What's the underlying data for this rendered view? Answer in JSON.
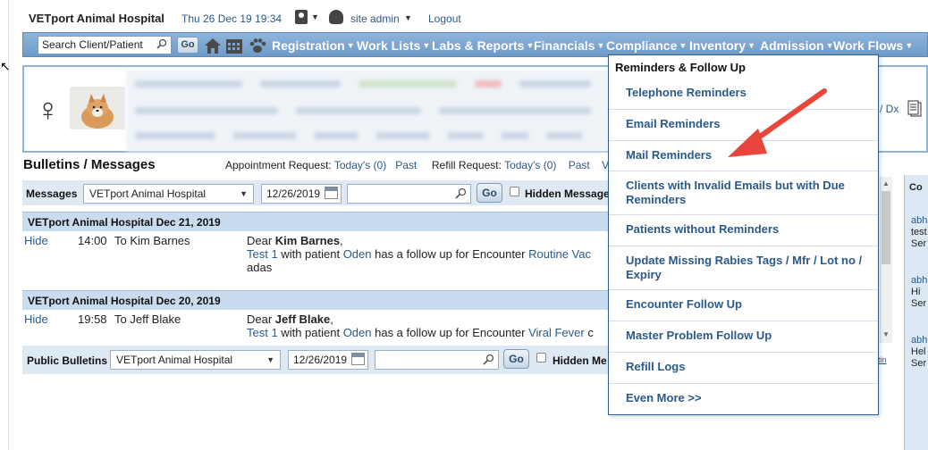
{
  "header": {
    "hospital_name": "VETport Animal Hospital",
    "datetime": "Thu 26 Dec 19 19:34",
    "user_label": "site admin",
    "logout_label": "Logout"
  },
  "nav": {
    "search_placeholder": "Search Client/Patient",
    "go_label": "Go",
    "items": [
      {
        "label": "Registration"
      },
      {
        "label": "Work Lists"
      },
      {
        "label": "Labs & Reports"
      },
      {
        "label": "Financials"
      },
      {
        "label": "Compliance"
      },
      {
        "label": "Inventory"
      },
      {
        "label": "Admission"
      },
      {
        "label": "Work Flows"
      }
    ]
  },
  "patient_card": {
    "dx_link": "/ Dx"
  },
  "bulletins": {
    "title": "Bulletins / Messages",
    "appointment_request_label": "Appointment Request:",
    "appointment_today": "Today's (0)",
    "appointment_past": "Past",
    "refill_request_label": "Refill Request:",
    "refill_today": "Today's (0)",
    "refill_past": "Past",
    "trailing": "V"
  },
  "messages_toolbar": {
    "label": "Messages",
    "hospital_select": "VETport Animal Hospital",
    "date": "12/26/2019",
    "go_label": "Go",
    "hidden_label": "Hidden Messages"
  },
  "messages": [
    {
      "header": "VETport Animal Hospital  Dec 21, 2019",
      "hide": "Hide",
      "time": "14:00",
      "to": "To Kim Barnes",
      "greeting": "Dear ",
      "name": "Kim Barnes",
      "comma": ",",
      "test_link": "Test 1",
      "with_patient": " with patient ",
      "patient_link": "Oden",
      "has_follow": " has a follow up for Encounter ",
      "encounter_link": "Routine Vac",
      "extra_line": "adas"
    },
    {
      "header": "VETport Animal Hospital  Dec 20, 2019",
      "hide": "Hide",
      "time": "19:58",
      "to": "To Jeff Blake",
      "greeting": "Dear ",
      "name": "Jeff Blake",
      "comma": ",",
      "test_link": "Test 1",
      "with_patient": " with patient ",
      "patient_link": "Oden",
      "has_follow": " has a follow up for Encounter ",
      "encounter_link": "Viral Fever",
      "trailing": " c"
    }
  ],
  "public_toolbar": {
    "label": "Public Bulletins",
    "hospital_select": "VETport Animal Hospital",
    "date": "12/26/2019",
    "go_label": "Go",
    "hidden_label": "Hidden Me",
    "right_link": "tin"
  },
  "right_panel": {
    "header": "Co",
    "entries": [
      {
        "line1": "abh",
        "line2": "test",
        "line3": "Ser"
      },
      {
        "line1": "abh",
        "line2": "Hi",
        "line3": "Ser"
      },
      {
        "line1": "abh",
        "line2": "Hel",
        "line3": "Ser"
      }
    ]
  },
  "dropdown": {
    "title": "Reminders & Follow Up",
    "items": [
      {
        "line1": "Telephone Reminders"
      },
      {
        "line1": "Email Reminders"
      },
      {
        "line1": "Mail Reminders"
      },
      {
        "line1": "Clients with Invalid Emails but with Due",
        "line2": "Reminders"
      },
      {
        "line1": "Patients without Reminders"
      },
      {
        "line1": "Update Missing Rabies Tags / Mfr / Lot no /",
        "line2": "Expiry"
      },
      {
        "line1": "Encounter Follow Up"
      },
      {
        "line1": "Master Problem Follow Up"
      },
      {
        "line1": "Refill Logs"
      },
      {
        "line1": "Even More >>"
      }
    ]
  },
  "colors": {
    "nav_bg": "#7aa4cf",
    "link": "#2a5a8a",
    "arrow": "#e8453c"
  }
}
